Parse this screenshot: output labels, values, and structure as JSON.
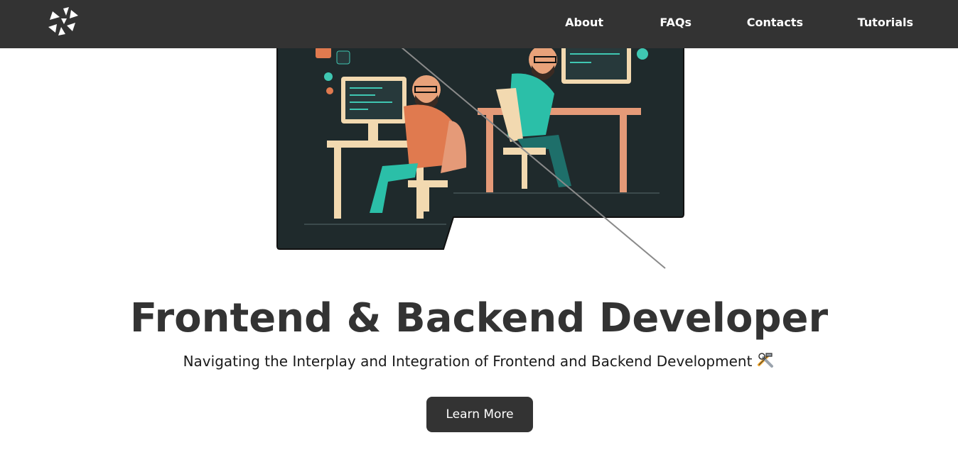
{
  "nav": {
    "logo_icon": "pinwheel-triangles-logo",
    "links": [
      "About",
      "FAQs",
      "Contacts",
      "Tutorials"
    ]
  },
  "hero": {
    "illustration": "two-developers-at-desks-illustration",
    "title": "Frontend & Backend Developer",
    "subtitle": "Navigating the Interplay and Integration of Frontend and Backend Development",
    "subtitle_icon": "hammer-and-wrench-icon",
    "cta_label": "Learn More"
  },
  "colors": {
    "navbar": "#333333",
    "button": "#333333",
    "heading": "#333333",
    "illustration_bg": "#1f2a2c",
    "accent_teal": "#2bbfa8",
    "accent_orange": "#e07a4f"
  }
}
